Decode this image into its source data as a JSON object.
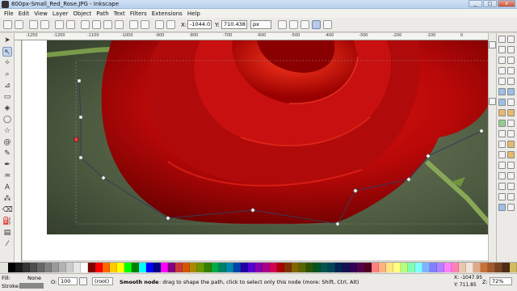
{
  "window": {
    "title": "800px-Small_Red_Rose.JPG - Inkscape",
    "minimize": "_",
    "maximize": "□",
    "close": "x"
  },
  "menu": [
    "File",
    "Edit",
    "View",
    "Layer",
    "Object",
    "Path",
    "Text",
    "Filters",
    "Extensions",
    "Help"
  ],
  "controls": {
    "x_label": "X:",
    "x_value": "-1044.0",
    "y_label": "Y:",
    "y_value": "710.438",
    "unit": "px"
  },
  "ruler": {
    "ticks": [
      "-1250",
      "-1200",
      "-1100",
      "-1000",
      "-900",
      "-800",
      "-700",
      "-600",
      "-500",
      "-400",
      "-300",
      "-200",
      "-100",
      "0",
      "100"
    ]
  },
  "palette": {
    "colors": [
      "#000000",
      "#1a1a1a",
      "#333333",
      "#4d4d4d",
      "#666666",
      "#808080",
      "#999999",
      "#b3b3b3",
      "#cccccc",
      "#e6e6e6",
      "#ffffff",
      "#800000",
      "#ff0000",
      "#ff6600",
      "#ffcc00",
      "#ffff00",
      "#00ff00",
      "#008000",
      "#00ffff",
      "#0000ff",
      "#000080",
      "#ff00ff",
      "#800080",
      "#c83737",
      "#d45500",
      "#aa8800",
      "#669900",
      "#338000",
      "#00aa44",
      "#008066",
      "#0088aa",
      "#0044aa",
      "#2200aa",
      "#5500d4",
      "#8800aa",
      "#aa0088",
      "#d40055",
      "#aa0000",
      "#803300",
      "#806600",
      "#556600",
      "#2b5500",
      "#005522",
      "#00554d",
      "#004455",
      "#002255",
      "#161155",
      "#330055",
      "#55004d",
      "#550022",
      "#ff8080",
      "#ffb380",
      "#ffe680",
      "#ffff80",
      "#b3ff80",
      "#80ffb3",
      "#80ffff",
      "#80b3ff",
      "#8080ff",
      "#b380ff",
      "#ff80ff",
      "#ff80b3",
      "#e9c6af",
      "#f4e3d7",
      "#deaa87",
      "#c87137",
      "#a05a2c",
      "#784421",
      "#502d16",
      "#d3bc5f",
      "#c8ab37"
    ]
  },
  "status": {
    "fill_label": "Fill:",
    "fill_value": "None",
    "stroke_label": "Stroke:",
    "o_label": "O:",
    "o_value": "100",
    "layer_value": "(root)",
    "message_bold": "Smooth node",
    "message_rest": ": drag to shape the path, click to select only this node (more: Shift, Ctrl, Alt)",
    "x_coord": "X: -1047.95",
    "y_coord": "Y: 711.85",
    "z_label": "Z:",
    "zoom_value": "72%"
  },
  "colors": {
    "accent": "#c4d3ea",
    "rose_dark": "#7a0000",
    "rose_main": "#c40a0a",
    "background_green": "#56664a"
  }
}
